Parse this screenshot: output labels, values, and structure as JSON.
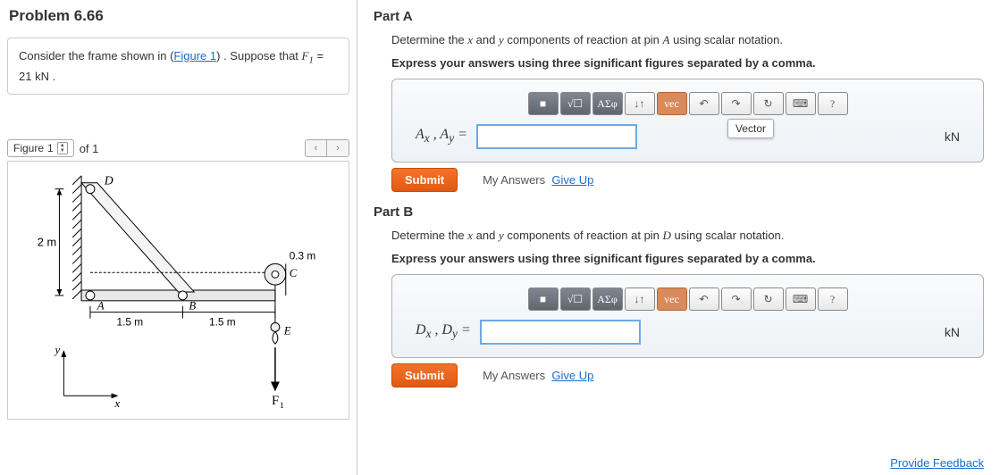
{
  "problem": {
    "title": "Problem 6.66",
    "consider_pre": "Consider the frame shown in (",
    "figure_link": "Figure 1",
    "consider_post": ") . Suppose that ",
    "force_var": "F",
    "force_sub": "1",
    "force_eq": " = 21  kN .",
    "force_value_kN": 21
  },
  "figure": {
    "label": "Figure",
    "current": "1",
    "of_text": "of 1",
    "dimensions": {
      "height_D_to_A_m": 2,
      "A_to_B_m": 1.5,
      "B_to_C_m": 1.5,
      "C_offset_m": 0.3
    },
    "labels": {
      "D": "D",
      "A": "A",
      "B": "B",
      "C": "C",
      "E": "E",
      "F1": "F",
      "x": "x",
      "y": "y",
      "two_m": "2 m",
      "p3m": "0.3 m",
      "l1": "1.5 m",
      "l2": "1.5 m"
    }
  },
  "partA": {
    "title": "Part A",
    "instr1_pre": "Determine the ",
    "instr1_x": "x",
    "instr1_mid": " and ",
    "instr1_y": "y",
    "instr1_post": " components of reaction at pin ",
    "instr1_pin": "A",
    "instr1_end": " using scalar notation.",
    "instr2": "Express your answers using three significant figures separated by a comma.",
    "answer_label": "A",
    "answer_sub1": "x",
    "answer_sep": " , ",
    "answer_sub2": "y",
    "answer_eq": " = ",
    "unit": "kN",
    "vec_tooltip": "Vector",
    "value": ""
  },
  "partB": {
    "title": "Part B",
    "instr1_pre": "Determine the ",
    "instr1_x": "x",
    "instr1_mid": " and ",
    "instr1_y": "y",
    "instr1_post": " components of reaction at pin ",
    "instr1_pin": "D",
    "instr1_end": " using scalar notation.",
    "instr2": "Express your answers using three significant figures separated by a comma.",
    "answer_label": "D",
    "answer_sub1": "x",
    "answer_sep": " , ",
    "answer_sub2": "y",
    "answer_eq": " = ",
    "unit": "kN",
    "value": ""
  },
  "toolbar": {
    "t1": "■",
    "t2": "√☐",
    "t3": "ΑΣφ",
    "t4": "↓↑",
    "t5": "vec",
    "t6": "↶",
    "t7": "↷",
    "t8": "↻",
    "t9": "⌨",
    "t10": "?"
  },
  "buttons": {
    "submit": "Submit",
    "my_answers": "My Answers",
    "give_up": "Give Up",
    "feedback": "Provide Feedback"
  }
}
